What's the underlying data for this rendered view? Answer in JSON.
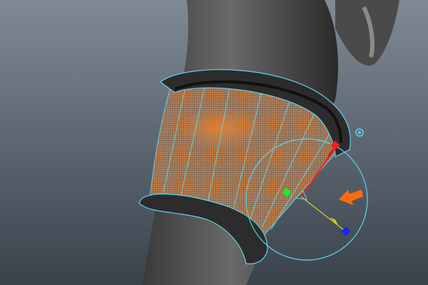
{
  "viewport": {
    "background_top": "#7f8994",
    "background_bottom": "#3a434c",
    "mesh_color": "#2a2a2a",
    "wireframe_color": "#5fd4ee",
    "fill_color": "#e0823a"
  },
  "manipulator": {
    "x_axis_color": "#ff1a1a",
    "y_axis_color": "#22ee22",
    "z_axis_color": "#1a22ff",
    "center_color": "#ffee00",
    "ring_color": "#5fd4ee"
  },
  "annotation": {
    "icon": "arrow-left-down-icon",
    "color": "#ff6a10"
  }
}
